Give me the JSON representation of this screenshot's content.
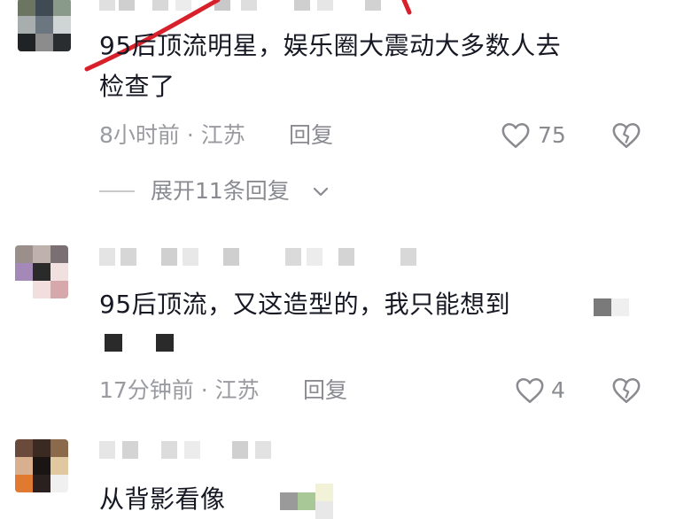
{
  "comments": [
    {
      "id": "c1",
      "text_line1": "95后顶流明星，娱乐圈大震动大多数人去",
      "text_line2": "检查了",
      "meta": "8小时前 · 江苏",
      "reply_label": "回复",
      "likes": "75",
      "expand_label": "展开11条回复"
    },
    {
      "id": "c2",
      "text": "95后顶流，又这造型的，我只能想到",
      "meta": "17分钟前 · 江苏",
      "reply_label": "回复",
      "likes": "4"
    },
    {
      "id": "c3",
      "text": "从背影看像"
    }
  ],
  "colors": {
    "text": "#161823",
    "meta": "#9a9ba1",
    "annotation_red": "#d8202a"
  },
  "icons": [
    "heart-outline-icon",
    "broken-heart-icon",
    "chevron-down-icon"
  ]
}
